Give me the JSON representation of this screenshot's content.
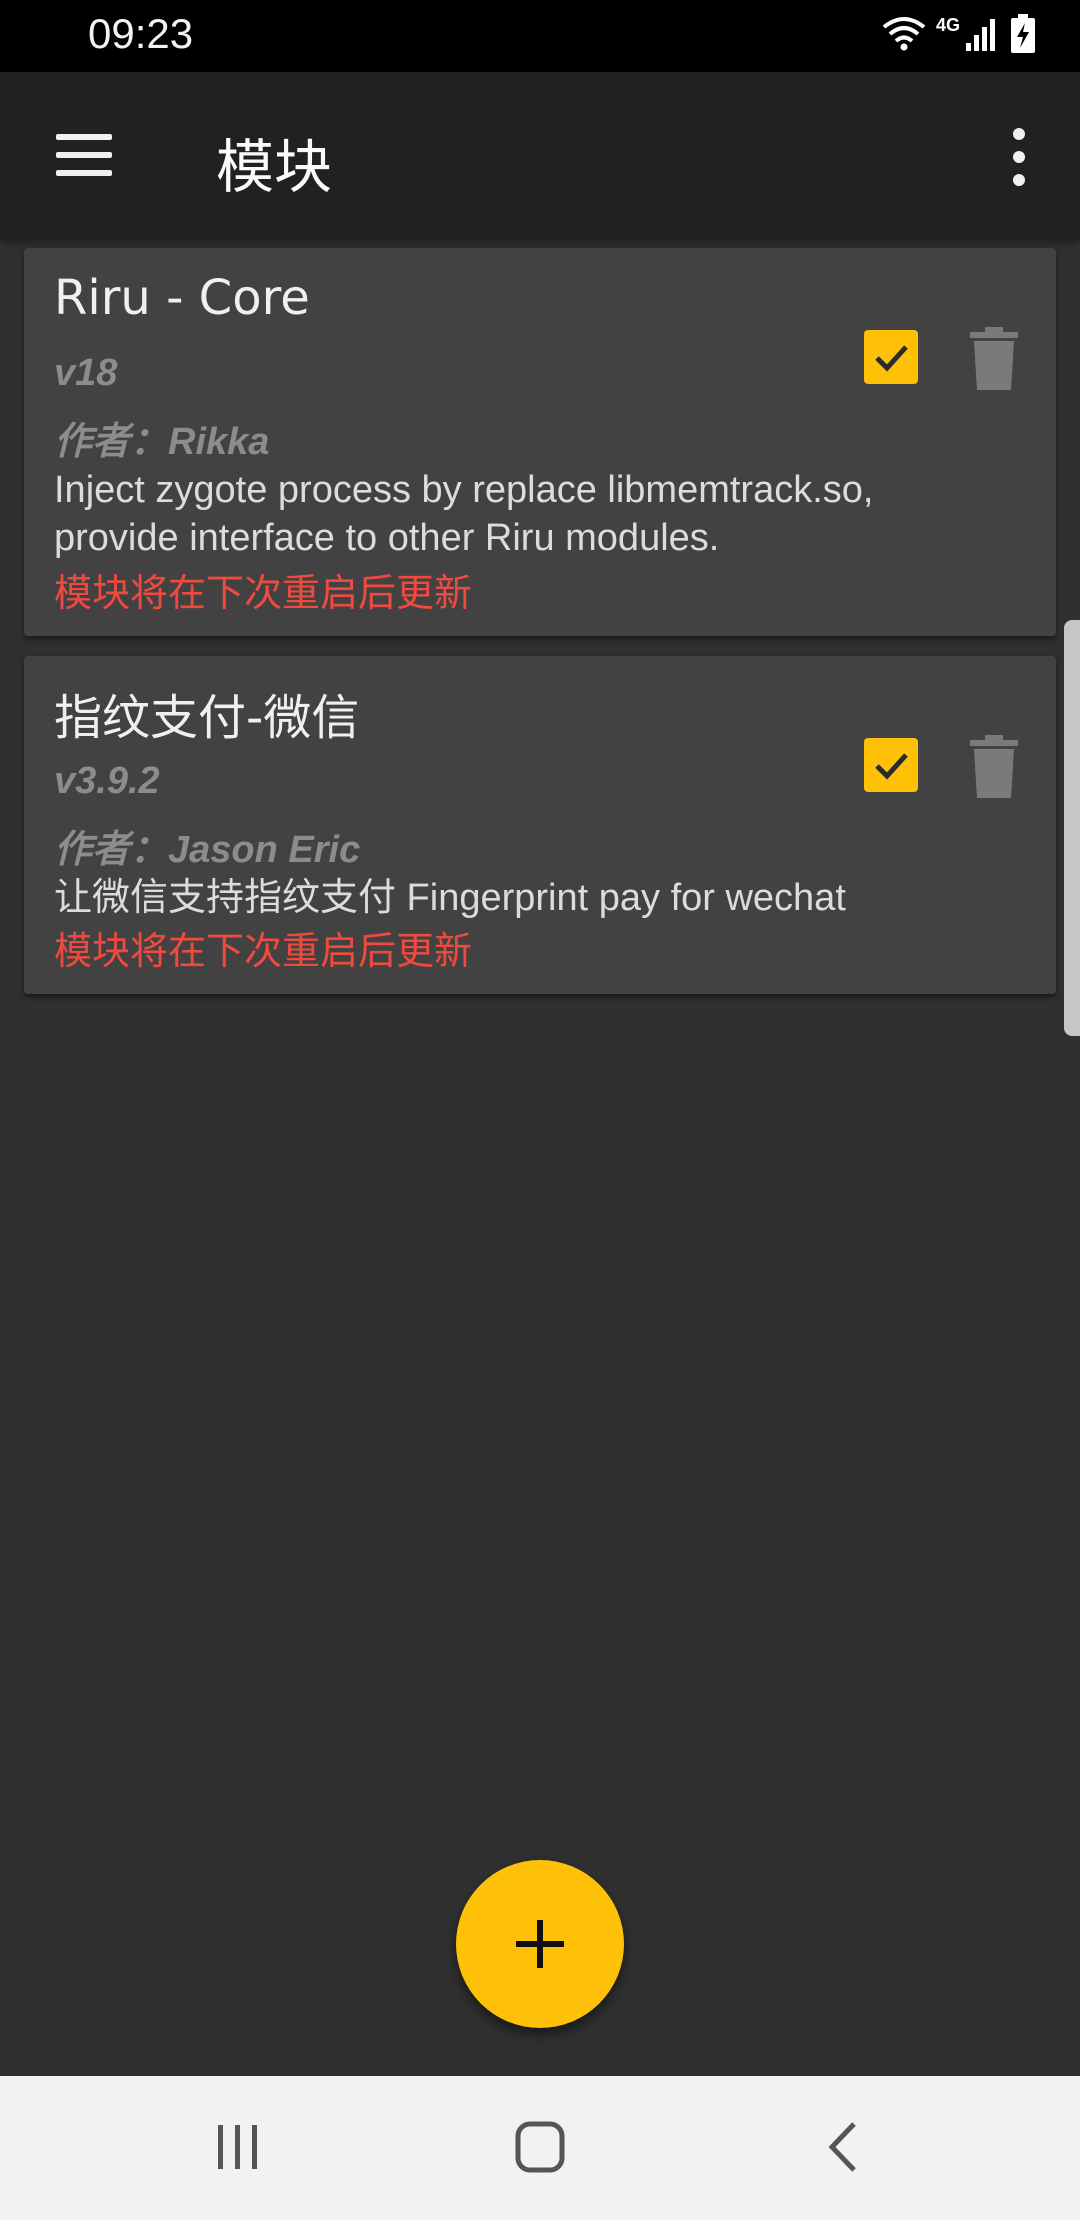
{
  "status_bar": {
    "time": "09:23",
    "network_label": "4G",
    "icons": [
      "wifi-icon",
      "cellular-signal-icon",
      "battery-charging-icon"
    ]
  },
  "app_bar": {
    "title": "模块",
    "icons": [
      "hamburger-menu-icon",
      "more-vert-icon"
    ]
  },
  "modules": [
    {
      "name": "Riru - Core",
      "version": "v18",
      "author": "作者：Rikka",
      "description": "Inject zygote process by replace libmemtrack.so, provide interface to other Riru modules.",
      "pending": "模块将在下次重启后更新",
      "enabled": true
    },
    {
      "name": "指纹支付-微信",
      "version": "v3.9.2",
      "author": "作者：Jason Eric",
      "description": "让微信支持指纹支付 Fingerprint pay for wechat",
      "pending": "模块将在下次重启后更新",
      "enabled": true
    }
  ],
  "fab": {
    "icon": "add-icon"
  },
  "nav_bar": {
    "icons": [
      "recents-icon",
      "home-icon",
      "back-icon"
    ]
  },
  "colors": {
    "accent": "#ffc107",
    "pending_text": "#f04a3f",
    "background": "#303030",
    "card": "#424242",
    "app_bar": "#212121"
  }
}
